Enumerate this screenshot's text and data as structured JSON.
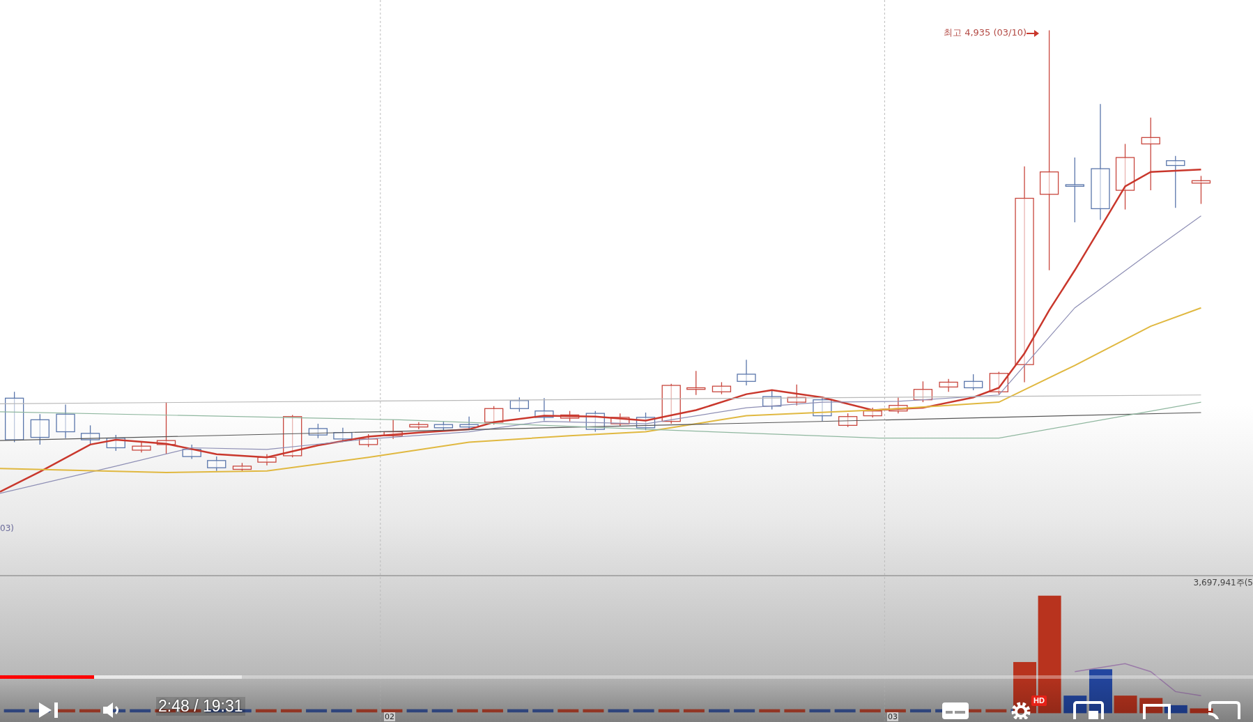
{
  "chart": {
    "high_label": "최고 4,935 (03/10)",
    "left_label": "03)",
    "volume_label": "3,697,941주(5",
    "axis_labels": [
      "02",
      "03"
    ]
  },
  "player": {
    "progress": {
      "level": 0.075
    },
    "buffer": {
      "level": 0.193
    },
    "time": "2:48 / 19:31",
    "hd_badge": "HD"
  }
}
